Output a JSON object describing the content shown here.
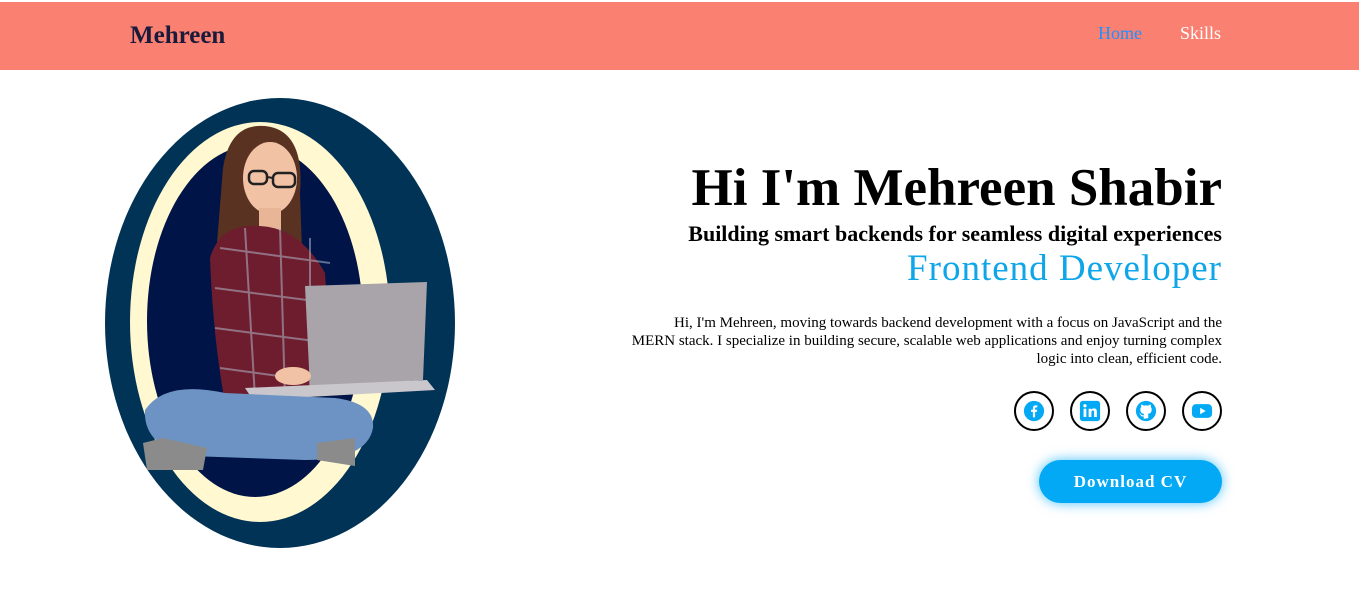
{
  "navbar": {
    "brand": "Mehreen",
    "links": [
      {
        "label": "Home",
        "active": true
      },
      {
        "label": "Skills",
        "active": false
      }
    ],
    "background": "#fa8072"
  },
  "hero": {
    "title": "Hi I'm Mehreen Shabir",
    "subtitle": "Building smart backends for seamless digital experiences",
    "role": "Frontend Developer",
    "description": "Hi, I'm Mehreen, moving towards backend development with a focus on JavaScript and the MERN stack. I specialize in building secure, scalable web applications and enjoy turning complex logic into clean, efficient code.",
    "accent_color": "#0ea5e9"
  },
  "socials": [
    {
      "icon": "facebook-icon"
    },
    {
      "icon": "linkedin-icon"
    },
    {
      "icon": "github-icon"
    },
    {
      "icon": "youtube-icon"
    }
  ],
  "cta": {
    "label": "Download CV",
    "color": "#03a9f4"
  },
  "portrait": {
    "outer_ring_color": "#003355",
    "mid_ring_color": "#fff8d0",
    "inner_color": "#001447"
  }
}
